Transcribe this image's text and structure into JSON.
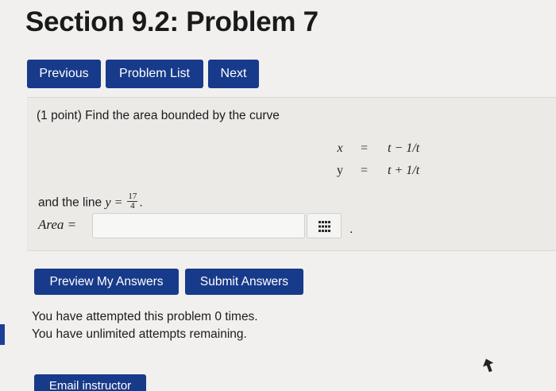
{
  "page": {
    "title": "Section 9.2: Problem 7"
  },
  "nav": {
    "previous_label": "Previous",
    "problem_list_label": "Problem List",
    "next_label": "Next"
  },
  "problem": {
    "statement": "(1 point) Find the area bounded by the curve",
    "equations": [
      {
        "var": "x",
        "eq": "=",
        "rhs": "t − 1/t"
      },
      {
        "var": "y",
        "eq": "=",
        "rhs": "t + 1/t"
      }
    ],
    "line_prefix": "and the line ",
    "line_math": "y = ",
    "line_fraction": {
      "numerator": "17",
      "denominator": "4"
    },
    "line_suffix": ".",
    "area_label": "Area =",
    "area_value": "",
    "trailing_dot": "."
  },
  "actions": {
    "preview_label": "Preview My Answers",
    "submit_label": "Submit Answers",
    "email_label": "Email instructor"
  },
  "attempts": {
    "line1": "You have attempted this problem 0 times.",
    "line2": "You have unlimited attempts remaining."
  },
  "colors": {
    "button_blue": "#173a8a",
    "background": "#f1f0ee",
    "problem_box": "#ebeae7"
  },
  "icons": {
    "answer_tool": "grid-icon",
    "pointer": "cursor-icon"
  }
}
